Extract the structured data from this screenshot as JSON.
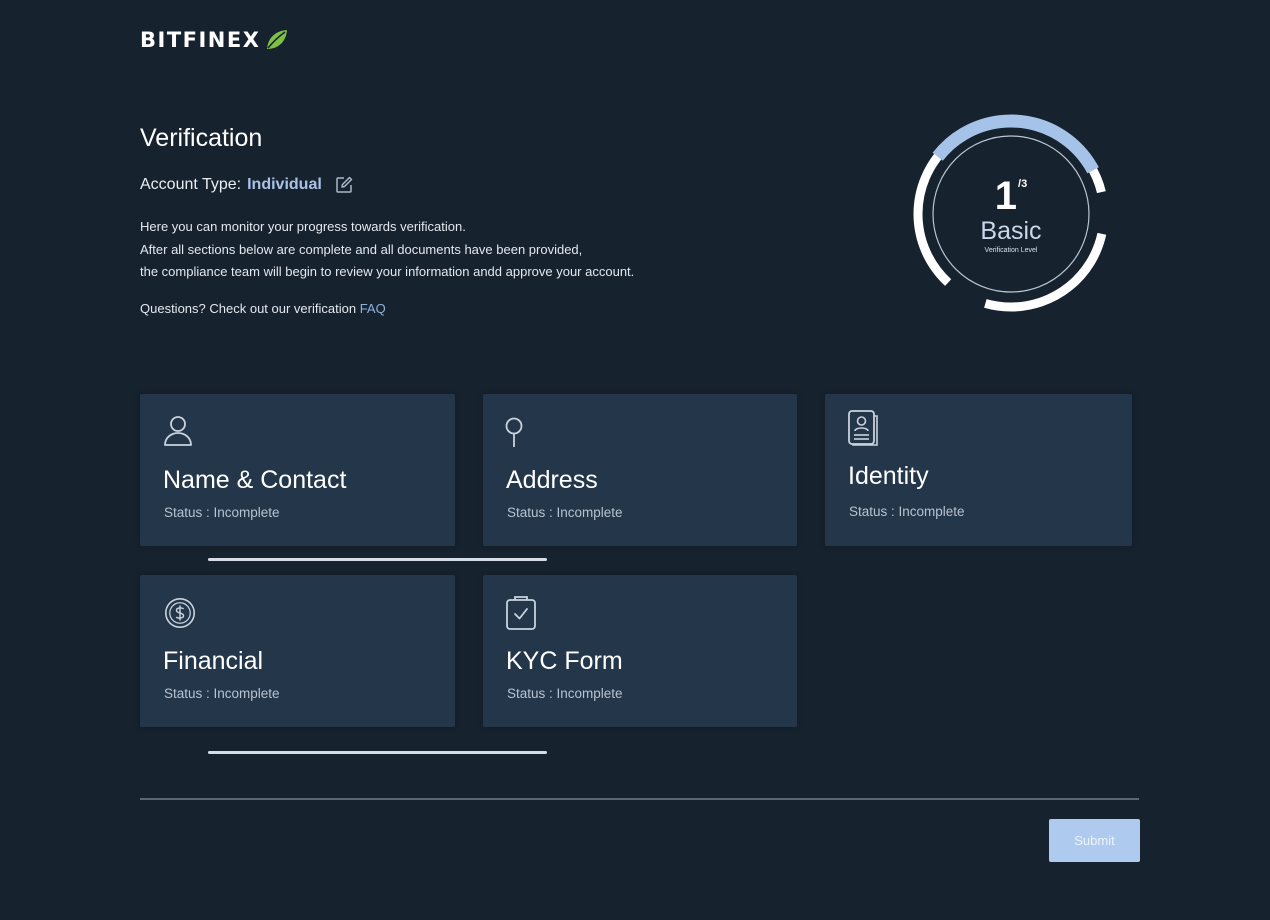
{
  "brand": {
    "name": "BITFINEX",
    "accent": "#7ec244"
  },
  "header": {
    "title": "Verification"
  },
  "account": {
    "label": "Account Type:",
    "value": "Individual"
  },
  "intro": {
    "lines": [
      "Here you can monitor your progress towards verification.",
      "After all sections below are complete and all documents have been provided,",
      "the compliance team will begin to review your information andd approve your account."
    ],
    "faq_prefix": "Questions? Check out our verification",
    "faq_link": "FAQ"
  },
  "level": {
    "current": "1",
    "total": "/3",
    "name": "Basic",
    "caption": "Verification Level",
    "progress": 0.333
  },
  "cards": [
    {
      "title": "Name & Contact",
      "status": "Status : Incomplete",
      "icon": "person-icon"
    },
    {
      "title": "Address",
      "status": "Status : Incomplete",
      "icon": "map-pin-icon"
    },
    {
      "title": "Identity",
      "status": "Status : Incomplete",
      "icon": "id-document-icon"
    },
    {
      "title": "Financial",
      "status": "Status : Incomplete",
      "icon": "dollar-circle-icon"
    },
    {
      "title": "KYC Form",
      "status": "Status : Incomplete",
      "icon": "clipboard-check-icon"
    }
  ],
  "actions": {
    "submit_label": "Submit"
  },
  "colors": {
    "background": "#17222f",
    "card": "#24364a",
    "ring_progress": "#a5c2e8",
    "ring_track": "#ffffff",
    "submit_bg": "#aecbef"
  }
}
